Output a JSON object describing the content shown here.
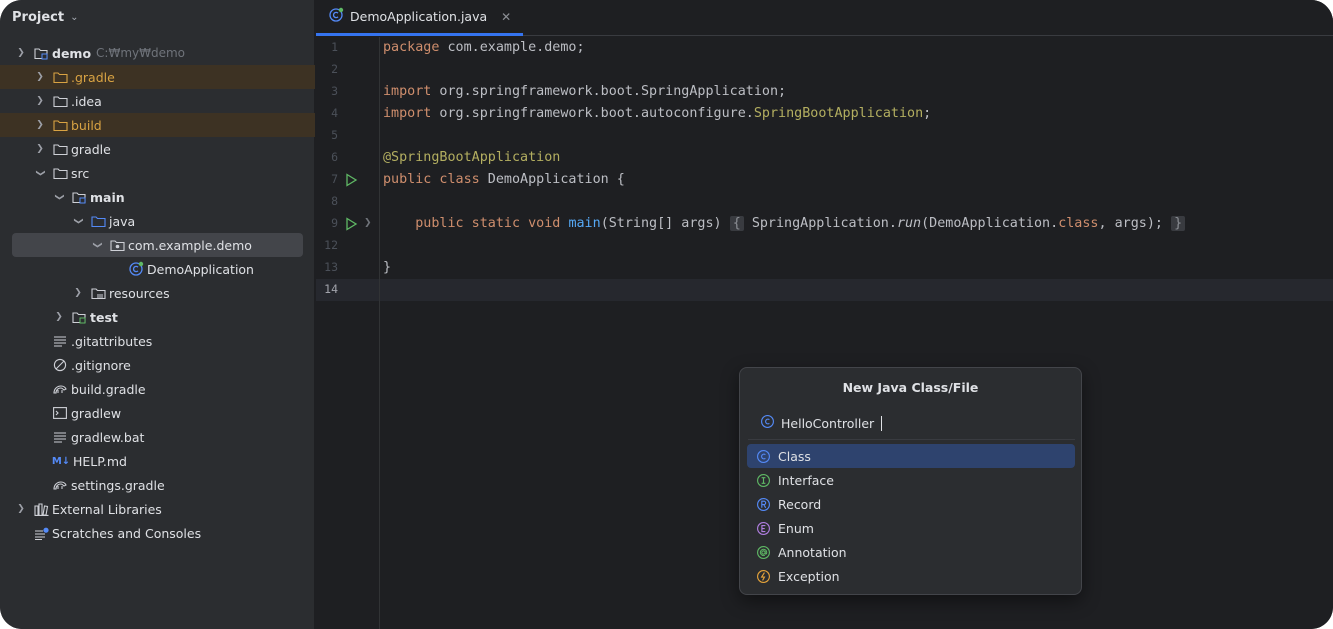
{
  "project_panel": {
    "title": "Project",
    "tree": [
      {
        "label": "demo",
        "path": "C:₩my₩demo",
        "bold": true,
        "icon": "module-folder-icon"
      },
      {
        "label": ".gradle",
        "icon": "folder-icon"
      },
      {
        "label": ".idea",
        "icon": "folder-icon"
      },
      {
        "label": "build",
        "icon": "folder-icon"
      },
      {
        "label": "gradle",
        "icon": "folder-icon"
      },
      {
        "label": "src",
        "icon": "folder-icon"
      },
      {
        "label": "main",
        "bold": true,
        "icon": "source-root-folder-icon"
      },
      {
        "label": "java",
        "icon": "java-folder-icon"
      },
      {
        "label": "com.example.demo",
        "icon": "package-icon"
      },
      {
        "label": "DemoApplication",
        "icon": "spring-class-icon"
      },
      {
        "label": "resources",
        "icon": "resources-folder-icon"
      },
      {
        "label": "test",
        "bold": true,
        "icon": "test-folder-icon"
      },
      {
        "label": ".gitattributes",
        "icon": "text-file-icon"
      },
      {
        "label": ".gitignore",
        "icon": "ignore-file-icon"
      },
      {
        "label": "build.gradle",
        "icon": "gradle-file-icon"
      },
      {
        "label": "gradlew",
        "icon": "shell-script-icon"
      },
      {
        "label": "gradlew.bat",
        "icon": "text-file-icon"
      },
      {
        "label": "HELP.md",
        "icon": "markdown-icon"
      },
      {
        "label": "settings.gradle",
        "icon": "gradle-file-icon"
      },
      {
        "label": "External Libraries",
        "icon": "libraries-icon"
      },
      {
        "label": "Scratches and Consoles",
        "icon": "scratches-icon"
      }
    ]
  },
  "editor": {
    "tab_label": "DemoApplication.java",
    "line_numbers": [
      "1",
      "2",
      "3",
      "4",
      "5",
      "6",
      "7",
      "8",
      "9",
      "12",
      "13",
      "14"
    ],
    "code": {
      "l1_kw": "package",
      "l1_rest": " com.example.demo;",
      "l3_kw": "import",
      "l3_rest": " org.springframework.boot.SpringApplication;",
      "l4_kw": "import",
      "l4_rest": " org.springframework.boot.autoconfigure.",
      "l4_ann": "SpringBootApplication",
      "l4_end": ";",
      "l6_ann": "@SpringBootApplication",
      "l7_kw": "public class",
      "l7_rest": " DemoApplication {",
      "l9_kw": "public static void",
      "l9_fn": "main",
      "l9_args": "(String[] args)",
      "l9_open": "{",
      "l9_call": "SpringApplication.",
      "l9_run": "run",
      "l9_paren": "(DemoApplication.",
      "l9_class": "class",
      "l9_tail": ", args);",
      "l9_close": "}",
      "l13": "}"
    }
  },
  "popup": {
    "title": "New Java Class/File",
    "input_value": "HelloController",
    "items": [
      {
        "label": "Class",
        "icon": "class-icon",
        "color": "#548af7"
      },
      {
        "label": "Interface",
        "icon": "interface-icon",
        "color": "#5fb865"
      },
      {
        "label": "Record",
        "icon": "record-icon",
        "color": "#548af7"
      },
      {
        "label": "Enum",
        "icon": "enum-icon",
        "color": "#b07ee0"
      },
      {
        "label": "Annotation",
        "icon": "annotation-icon",
        "color": "#5fb865"
      },
      {
        "label": "Exception",
        "icon": "exception-icon",
        "color": "#e5a33a"
      }
    ]
  }
}
